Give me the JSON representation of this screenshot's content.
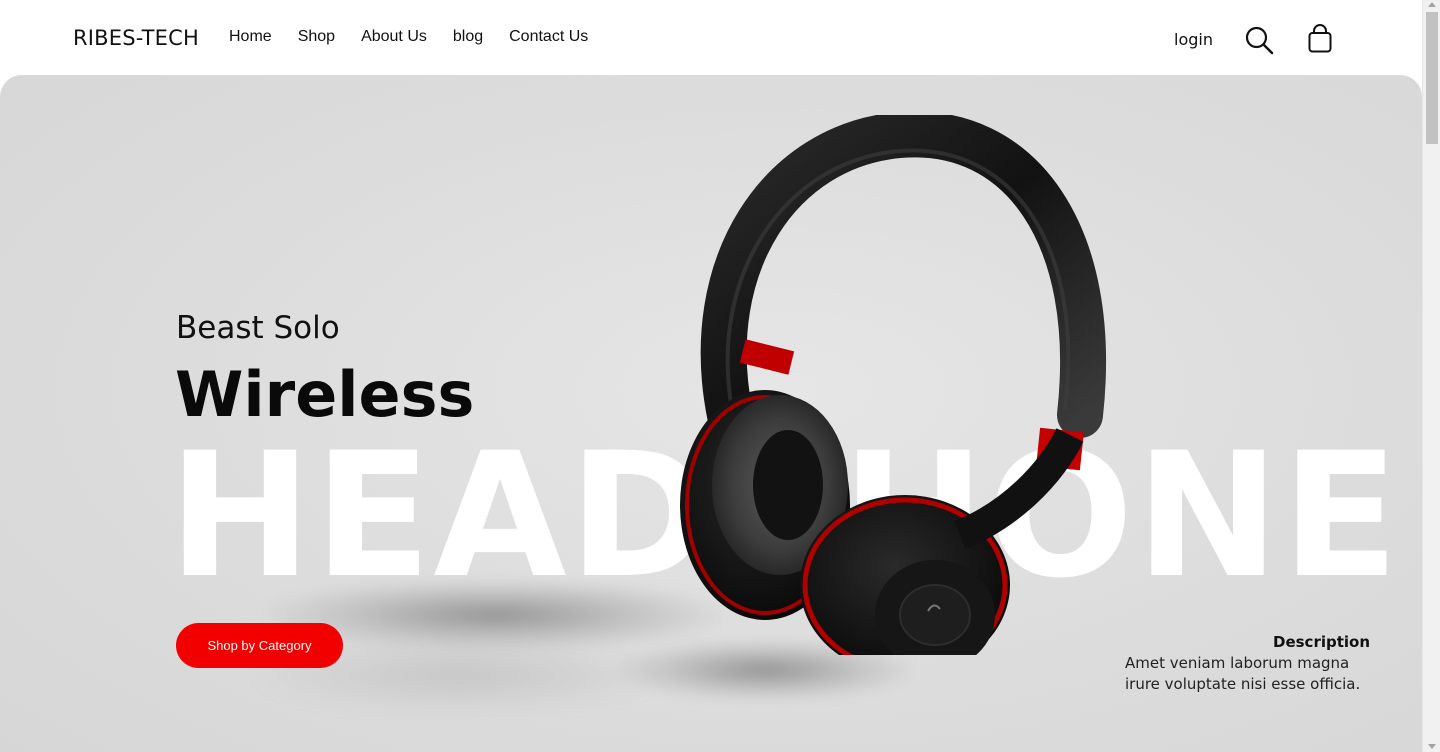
{
  "header": {
    "logo": "RIBES-TECH",
    "nav": [
      "Home",
      "Shop",
      "About Us",
      "blog",
      "Contact Us"
    ],
    "login": "login",
    "icons": {
      "search": "search-icon",
      "cart": "shopping-bag-icon"
    }
  },
  "hero": {
    "subtitle": "Beast Solo",
    "title": "Wireless",
    "background_word": "HEADPHONE",
    "cta_label": "Shop by Category",
    "description_title": "Description",
    "description_text": "Amet veniam laborum magna irure voluptate nisi esse officia.",
    "colors": {
      "accent": "#f20000",
      "background": "#dcdcdc",
      "text": "#111111"
    }
  }
}
